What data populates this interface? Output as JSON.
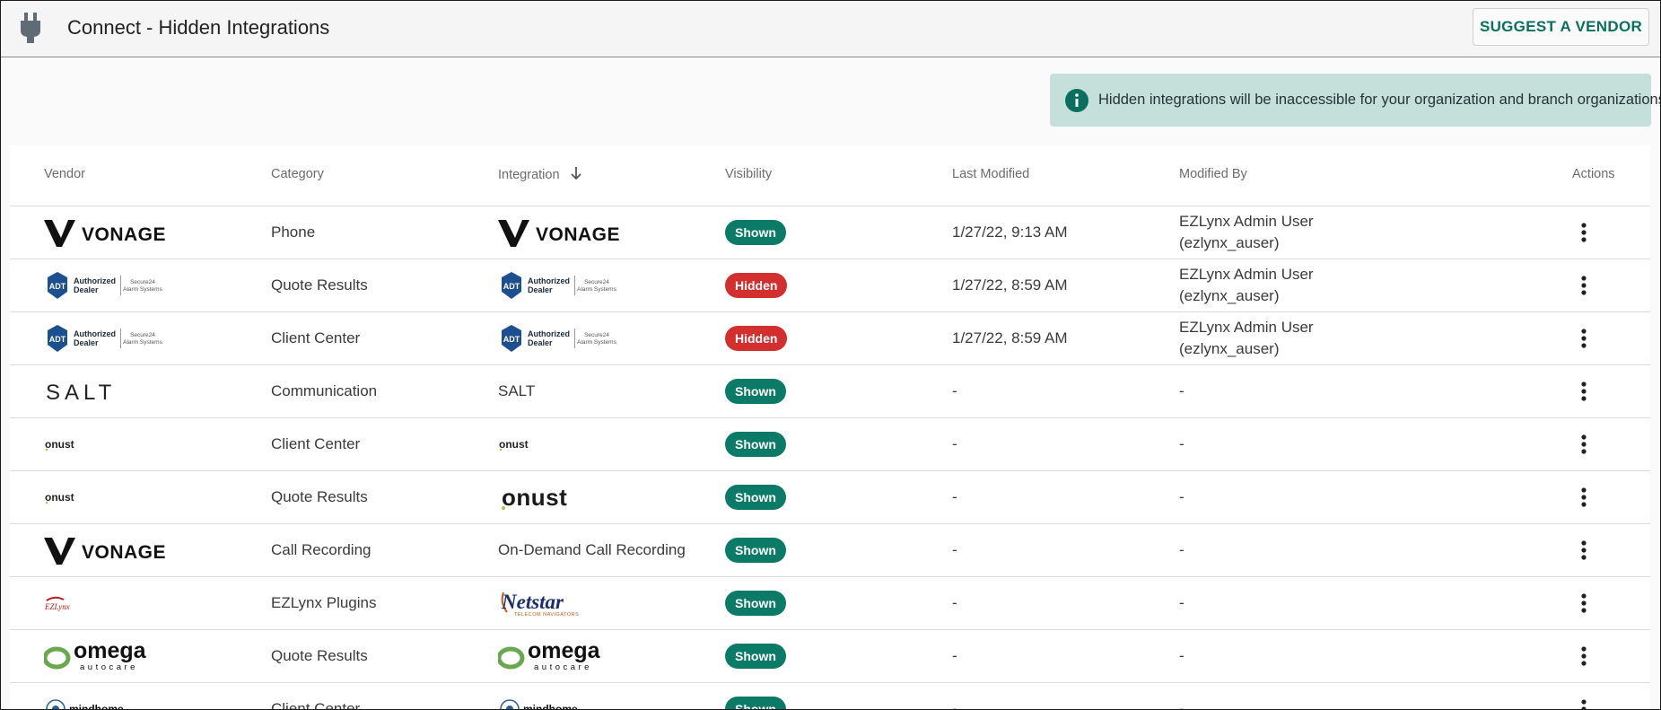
{
  "header": {
    "title": "Connect - Hidden Integrations",
    "suggest_button": "SUGGEST A VENDOR"
  },
  "banner": {
    "text": "Hidden integrations will be inaccessible for your organization and branch organizations.",
    "icon": "info-icon"
  },
  "colors": {
    "accent": "#0b6e5f",
    "shown": "#0b7a66",
    "hidden": "#d32f2f",
    "banner_bg": "#c5e0da"
  },
  "table": {
    "columns": {
      "vendor": "Vendor",
      "category": "Category",
      "integration": "Integration",
      "visibility": "Visibility",
      "last_modified": "Last Modified",
      "modified_by": "Modified By",
      "actions": "Actions"
    },
    "sort": {
      "column": "Integration",
      "direction": "descending"
    },
    "rows": [
      {
        "vendor_logo": "VONAGE",
        "category": "Phone",
        "integration_logo": "VONAGE",
        "integration_text": "",
        "visibility": "Shown",
        "last_modified": "1/27/22, 9:13 AM",
        "modified_by_1": "EZLynx Admin User",
        "modified_by_2": "(ezlynx_auser)"
      },
      {
        "vendor_logo": "ADT Authorized Dealer Secure24 Alarm Systems",
        "category": "Quote Results",
        "integration_logo": "ADT Authorized Dealer Secure24 Alarm Systems",
        "integration_text": "",
        "visibility": "Hidden",
        "last_modified": "1/27/22, 8:59 AM",
        "modified_by_1": "EZLynx Admin User",
        "modified_by_2": "(ezlynx_auser)"
      },
      {
        "vendor_logo": "ADT Authorized Dealer Secure24 Alarm Systems",
        "category": "Client Center",
        "integration_logo": "ADT Authorized Dealer Secure24 Alarm Systems",
        "integration_text": "",
        "visibility": "Hidden",
        "last_modified": "1/27/22, 8:59 AM",
        "modified_by_1": "EZLynx Admin User",
        "modified_by_2": "(ezlynx_auser)"
      },
      {
        "vendor_logo": "SALT",
        "category": "Communication",
        "integration_logo": "",
        "integration_text": "SALT",
        "visibility": "Shown",
        "last_modified": "-",
        "modified_by_1": "-",
        "modified_by_2": ""
      },
      {
        "vendor_logo": "onust",
        "category": "Client Center",
        "integration_logo": "onust",
        "integration_text": "",
        "visibility": "Shown",
        "last_modified": "-",
        "modified_by_1": "-",
        "modified_by_2": ""
      },
      {
        "vendor_logo": "onust",
        "category": "Quote Results",
        "integration_logo": "onust-large",
        "integration_text": "",
        "visibility": "Shown",
        "last_modified": "-",
        "modified_by_1": "-",
        "modified_by_2": ""
      },
      {
        "vendor_logo": "VONAGE",
        "category": "Call Recording",
        "integration_logo": "",
        "integration_text": "On-Demand Call Recording",
        "visibility": "Shown",
        "last_modified": "-",
        "modified_by_1": "-",
        "modified_by_2": ""
      },
      {
        "vendor_logo": "EZLynx",
        "category": "EZLynx Plugins",
        "integration_logo": "Netstar Telecom Navigators",
        "integration_text": "",
        "visibility": "Shown",
        "last_modified": "-",
        "modified_by_1": "-",
        "modified_by_2": ""
      },
      {
        "vendor_logo": "omega autocare",
        "category": "Quote Results",
        "integration_logo": "omega autocare",
        "integration_text": "",
        "visibility": "Shown",
        "last_modified": "-",
        "modified_by_1": "-",
        "modified_by_2": ""
      },
      {
        "vendor_logo": "mindhome",
        "category": "Client Center",
        "integration_logo": "mindhome",
        "integration_text": "",
        "visibility": "Shown",
        "last_modified": "-",
        "modified_by_1": "-",
        "modified_by_2": ""
      }
    ]
  }
}
